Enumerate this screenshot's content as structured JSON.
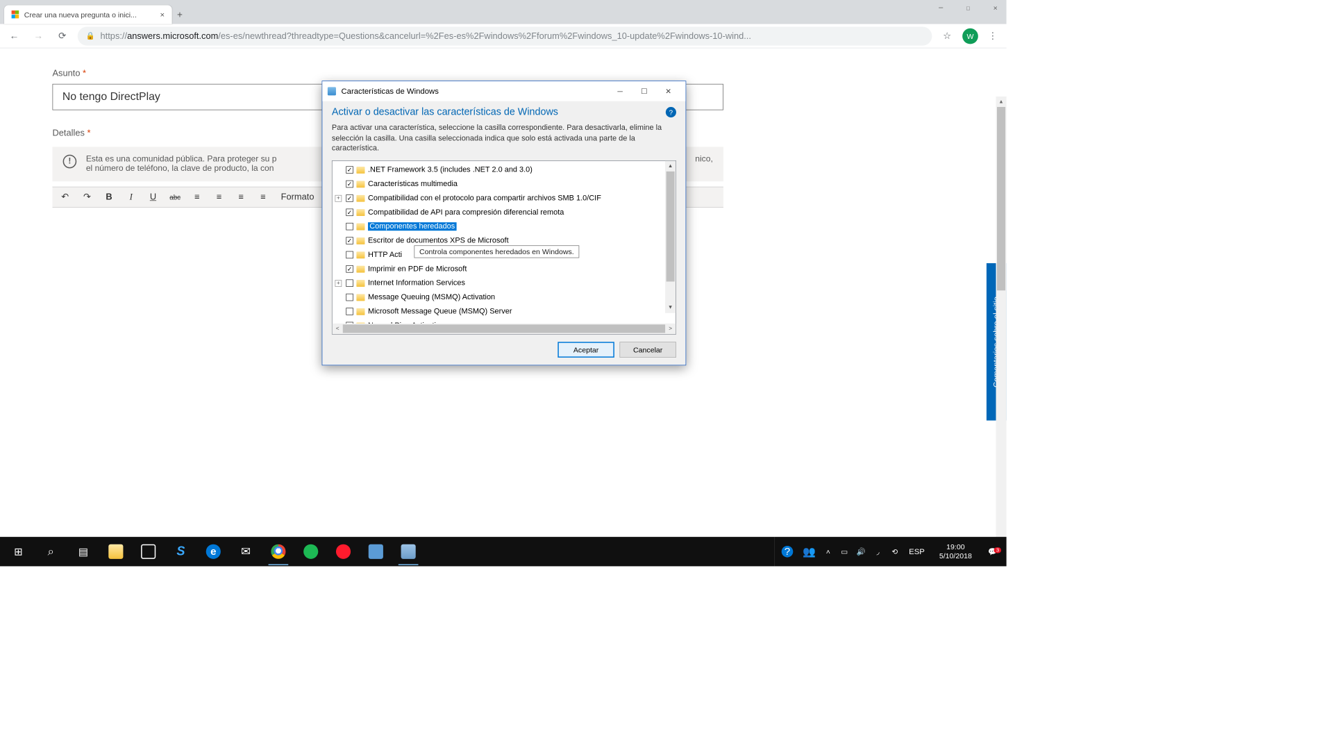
{
  "browser": {
    "tab_title": "Crear una nueva pregunta o inici...",
    "url_full": "https://answers.microsoft.com/es-es/newthread?threadtype=Questions&cancelurl=%2Fes-es%2Fwindows%2Fforum%2Fwindows_10-update%2Fwindows-10-wind...",
    "avatar_letter": "W"
  },
  "page": {
    "subject_label": "Asunto",
    "subject_value": "No tengo DirectPlay",
    "details_label": "Detalles",
    "info_text_line1": "Esta es una comunidad pública. Para proteger su p",
    "info_text_line2": "el número de teléfono, la clave de producto, la con",
    "info_text_right": "nico,",
    "format_label": "Formato",
    "feedback_tab": "Comentarios sobre el sitio"
  },
  "dialog": {
    "window_title": "Características de Windows",
    "heading": "Activar o desactivar las características de Windows",
    "description": "Para activar una característica, seleccione la casilla correspondiente. Para desactivarla, elimine la selección la casilla. Una casilla seleccionada indica que solo está activada una parte de la característica.",
    "tooltip": "Controla componentes heredados en Windows.",
    "ok_label": "Aceptar",
    "cancel_label": "Cancelar",
    "features": [
      {
        "label": ".NET Framework 3.5 (includes .NET 2.0 and 3.0)",
        "checked": true,
        "expandable": false
      },
      {
        "label": "Características multimedia",
        "checked": true,
        "expandable": false
      },
      {
        "label": "Compatibilidad con el protocolo para compartir archivos SMB 1.0/CIF",
        "checked": true,
        "expandable": true
      },
      {
        "label": "Compatibilidad de API para compresión diferencial remota",
        "checked": true,
        "expandable": false
      },
      {
        "label": "Componentes heredados",
        "checked": false,
        "expandable": false,
        "selected": true
      },
      {
        "label": "Escritor de documentos XPS de Microsoft",
        "checked": true,
        "expandable": false
      },
      {
        "label": "HTTP Acti",
        "checked": false,
        "expandable": false
      },
      {
        "label": "Imprimir en PDF de Microsoft",
        "checked": true,
        "expandable": false
      },
      {
        "label": "Internet Information Services",
        "checked": false,
        "expandable": true
      },
      {
        "label": "Message Queuing (MSMQ) Activation",
        "checked": false,
        "expandable": false
      },
      {
        "label": "Microsoft Message Queue (MSMQ) Server",
        "checked": false,
        "expandable": false
      },
      {
        "label": "Named Pipe Activation",
        "checked": false,
        "expandable": false
      }
    ]
  },
  "systray": {
    "lang": "ESP",
    "time": "19:00",
    "date": "5/10/2018",
    "notif_badge": "3"
  }
}
